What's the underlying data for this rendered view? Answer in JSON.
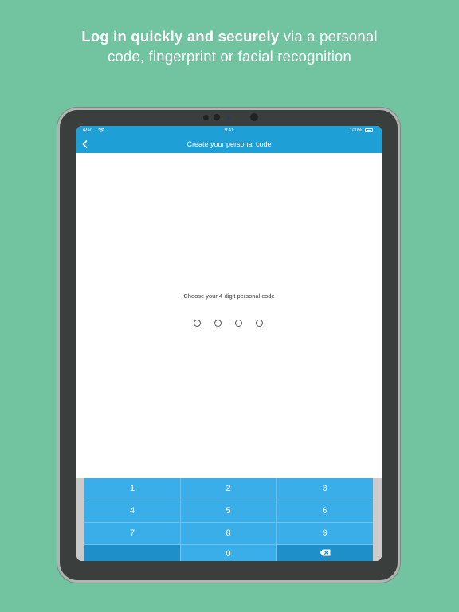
{
  "headline": {
    "bold": "Log in quickly and securely",
    "rest": "via a personal",
    "line2": "code, fingerprint or facial recognition"
  },
  "statusbar": {
    "carrier": "iPad",
    "time": "9:41",
    "battery": "100%"
  },
  "navbar": {
    "back_icon": "chevron-left-icon",
    "title": "Create your personal code"
  },
  "code_entry": {
    "prompt": "Choose your 4-digit personal code",
    "digits_entered": 0,
    "digits_total": 4
  },
  "keypad": {
    "keys": [
      "1",
      "2",
      "3",
      "4",
      "5",
      "6",
      "7",
      "8",
      "9",
      "0"
    ],
    "delete_icon": "backspace-icon"
  },
  "colors": {
    "background": "#72c4a1",
    "accent": "#1e9fd6",
    "key": "#3aaee8",
    "key_dark": "#1e8fc8"
  }
}
